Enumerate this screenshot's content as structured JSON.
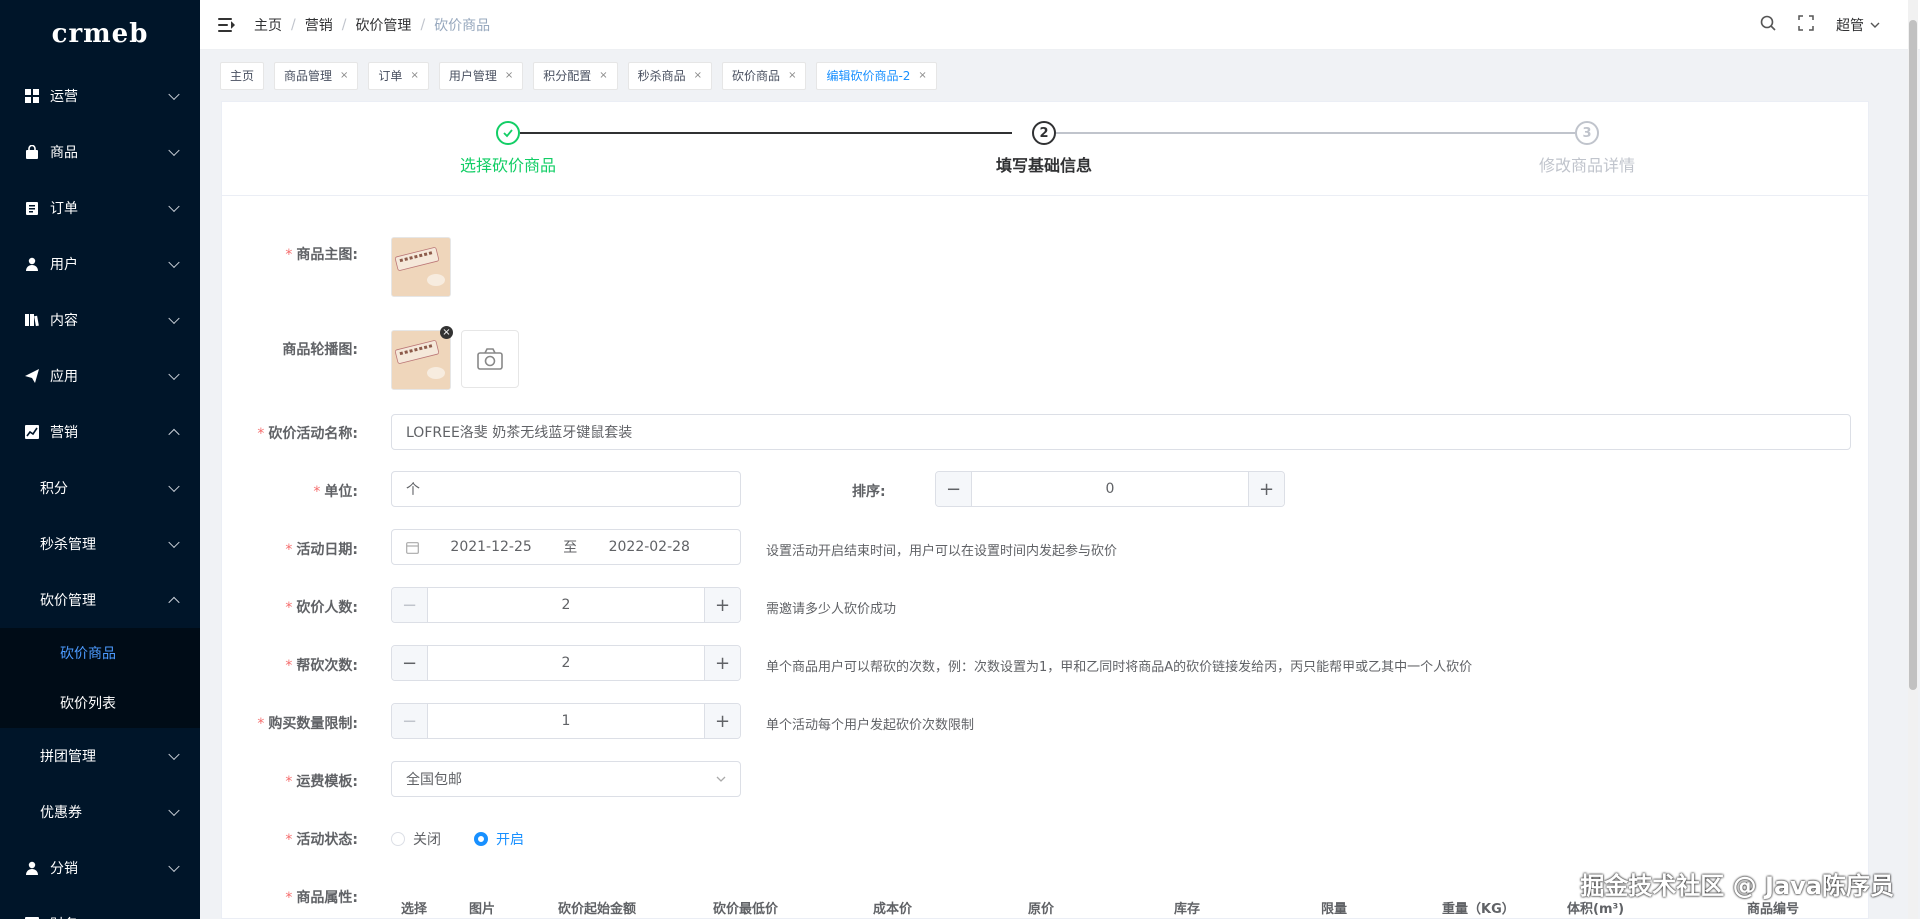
{
  "logo": "crmeb",
  "sidebar": {
    "items": [
      {
        "label": "运营",
        "icon": "grid-icon"
      },
      {
        "label": "商品",
        "icon": "bag-icon"
      },
      {
        "label": "订单",
        "icon": "clipboard-icon"
      },
      {
        "label": "用户",
        "icon": "user-icon"
      },
      {
        "label": "内容",
        "icon": "book-icon"
      },
      {
        "label": "应用",
        "icon": "send-icon"
      },
      {
        "label": "营销",
        "icon": "chart-icon"
      }
    ],
    "marketing_sub": [
      "积分",
      "秒杀管理",
      "砍价管理"
    ],
    "bargain_sub": [
      "砍价商品",
      "砍价列表"
    ],
    "marketing_sub2": [
      "拼团管理",
      "优惠券"
    ],
    "distribution": "分销",
    "finance": "财务"
  },
  "breadcrumb": [
    "主页",
    "营销",
    "砍价管理",
    "砍价商品"
  ],
  "user_name": "超管",
  "tabs": [
    {
      "label": "主页",
      "closable": false
    },
    {
      "label": "商品管理",
      "closable": true
    },
    {
      "label": "订单",
      "closable": true
    },
    {
      "label": "用户管理",
      "closable": true
    },
    {
      "label": "积分配置",
      "closable": true
    },
    {
      "label": "秒杀商品",
      "closable": true
    },
    {
      "label": "砍价商品",
      "closable": true
    },
    {
      "label": "编辑砍价商品-2",
      "closable": true
    }
  ],
  "steps": [
    {
      "title": "选择砍价商品",
      "status": "done"
    },
    {
      "title": "填写基础信息",
      "status": "active",
      "number": "2"
    },
    {
      "title": "修改商品详情",
      "status": "wait",
      "number": "3"
    }
  ],
  "form": {
    "main_image_label": "商品主图:",
    "carousel_label": "商品轮播图:",
    "name_label": "砍价活动名称:",
    "name_value": "LOFREE洛斐 奶茶无线蓝牙键鼠套装",
    "unit_label": "单位:",
    "unit_value": "个",
    "sort_label": "排序:",
    "sort_value": "0",
    "date_label": "活动日期:",
    "date_start": "2021-12-25",
    "date_sep": "至",
    "date_end": "2022-02-28",
    "date_hint": "设置活动开启结束时间，用户可以在设置时间内发起参与砍价",
    "people_label": "砍价人数:",
    "people_value": "2",
    "people_hint": "需邀请多少人砍价成功",
    "help_label": "帮砍次数:",
    "help_value": "2",
    "help_hint": "单个商品用户可以帮砍的次数，例：次数设置为1，甲和乙同时将商品A的砍价链接发给丙，丙只能帮甲或乙其中一个人砍价",
    "limit_label": "购买数量限制:",
    "limit_value": "1",
    "limit_hint": "单个活动每个用户发起砍价次数限制",
    "shipping_label": "运费模板:",
    "shipping_value": "全国包邮",
    "status_label": "活动状态:",
    "status_off": "关闭",
    "status_on": "开启",
    "attr_label": "商品属性:",
    "attr_headers": [
      "选择",
      "图片",
      "砍价起始金额",
      "砍价最低价",
      "成本价",
      "原价",
      "库存",
      "限量",
      "重量（KG）",
      "体积(m³)",
      "商品编号"
    ]
  },
  "colors": {
    "sidebar": "#001529",
    "accent": "#1890ff",
    "success": "#13ce66"
  },
  "watermark": "掘金技术社区 @ Java陈序员"
}
